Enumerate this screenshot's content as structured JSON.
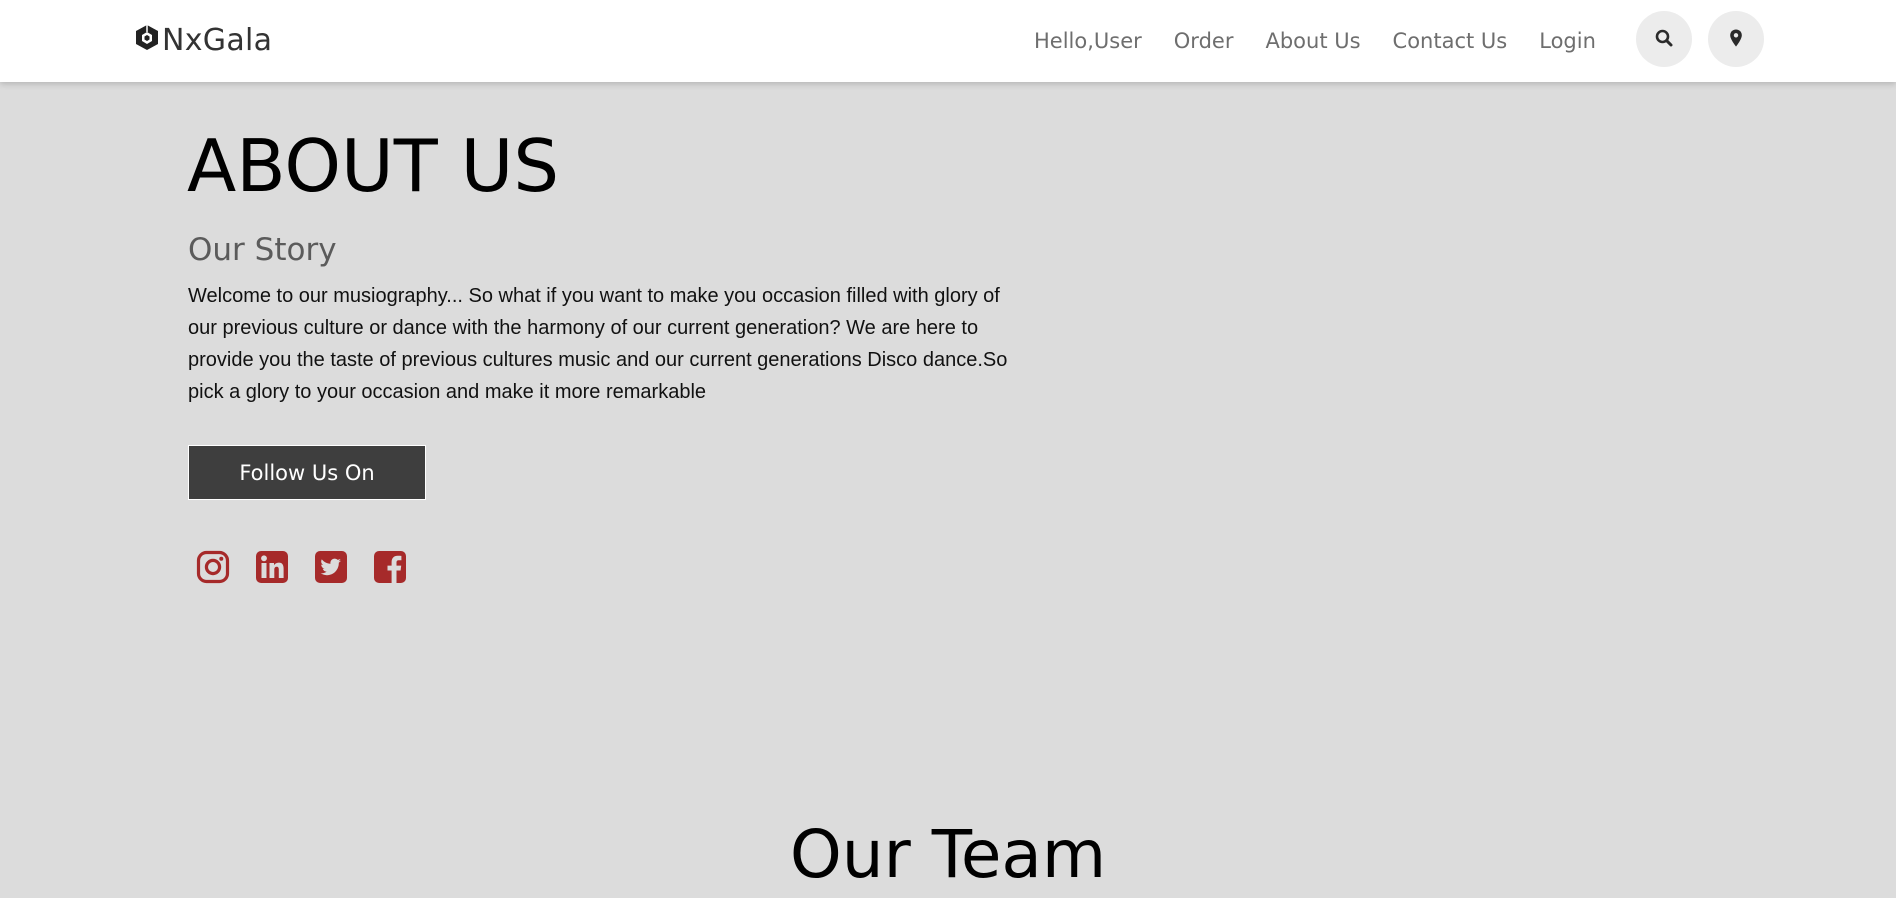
{
  "brand": {
    "name": "NxGala",
    "icon": "hexagon-logo-icon"
  },
  "nav": {
    "links": [
      "Hello,User",
      "Order",
      "About Us",
      "Contact Us",
      "Login"
    ],
    "search_icon": "search-icon",
    "location_icon": "map-marker-icon"
  },
  "about": {
    "title": "ABOUT US",
    "subtitle": "Our Story",
    "body": "Welcome to our musiography... So what if you want to make you occasion filled with glory of our previous culture or dance with the harmony of our current generation? We are here to provide you the taste of previous cultures music and our current generations Disco dance.So pick a glory to your occasion and make it more remarkable",
    "follow_label": "Follow Us On",
    "social": [
      "instagram-icon",
      "linkedin-icon",
      "twitter-icon",
      "facebook-icon"
    ]
  },
  "team": {
    "title": "Our Team"
  },
  "colors": {
    "page_bg": "#dcdcdc",
    "nav_bg": "#ffffff",
    "button_bg": "#3e3e3e",
    "social_accent": "#a62a2a"
  }
}
